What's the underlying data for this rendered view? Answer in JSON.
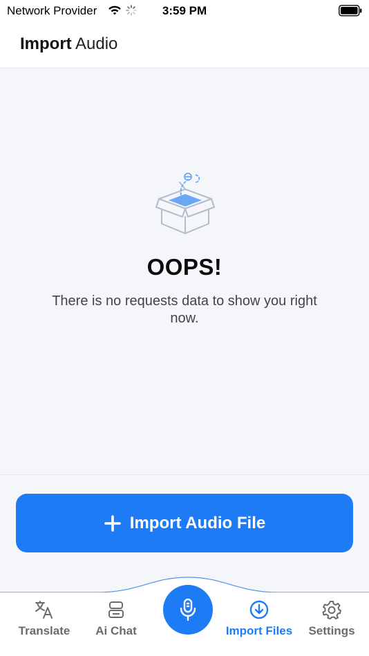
{
  "status_bar": {
    "carrier": "Network Provider",
    "time": "3:59 PM"
  },
  "header": {
    "title_bold": "Import",
    "title_light": "Audio"
  },
  "empty_state": {
    "title": "OOPS!",
    "message": "There is no requests data to show you right now.",
    "illustration_icon": "empty-box-icon"
  },
  "import_button": {
    "label": "Import Audio File",
    "icon": "plus-icon"
  },
  "tabs": [
    {
      "label": "Translate",
      "icon": "translate-icon",
      "active": false
    },
    {
      "label": "Ai Chat",
      "icon": "robot-icon",
      "active": false
    },
    {
      "label": "Import Files",
      "icon": "download-circle-icon",
      "active": true
    },
    {
      "label": "Settings",
      "icon": "gear-icon",
      "active": false
    }
  ],
  "mic_button": {
    "icon": "microphone-icon"
  },
  "colors": {
    "accent": "#1d7cf5",
    "background": "#f5f6fa",
    "inactive_tab": "#6b6b6b"
  }
}
